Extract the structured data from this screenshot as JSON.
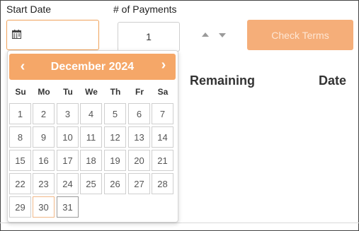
{
  "form": {
    "start_date_label": "Start Date",
    "payments_label": "# of Payments",
    "start_date_value": "",
    "payments_value": "1",
    "check_terms_label": "Check Terms"
  },
  "table": {
    "headers": [
      "Remaining",
      "Date"
    ]
  },
  "datepicker": {
    "title": "December 2024",
    "prev_glyph": "‹",
    "next_glyph": "›",
    "weekdays": [
      "Su",
      "Mo",
      "Tu",
      "We",
      "Th",
      "Fr",
      "Sa"
    ],
    "days": [
      "1",
      "2",
      "3",
      "4",
      "5",
      "6",
      "7",
      "8",
      "9",
      "10",
      "11",
      "12",
      "13",
      "14",
      "15",
      "16",
      "17",
      "18",
      "19",
      "20",
      "21",
      "22",
      "23",
      "24",
      "25",
      "26",
      "27",
      "28",
      "29",
      "30",
      "31"
    ],
    "first_weekday_index": 0,
    "today_day": 30,
    "selected_day": 31
  },
  "icons": {
    "date_input": "calendar-icon",
    "prev": "chevron-left-icon",
    "next": "chevron-right-icon",
    "spinner_up": "triangle-up-icon",
    "spinner_down": "triangle-down-icon"
  },
  "colors": {
    "accent": "#f5a768",
    "button": "#f5ae79",
    "button_text": "#fde6d4",
    "focus_border": "#f0a25a"
  }
}
